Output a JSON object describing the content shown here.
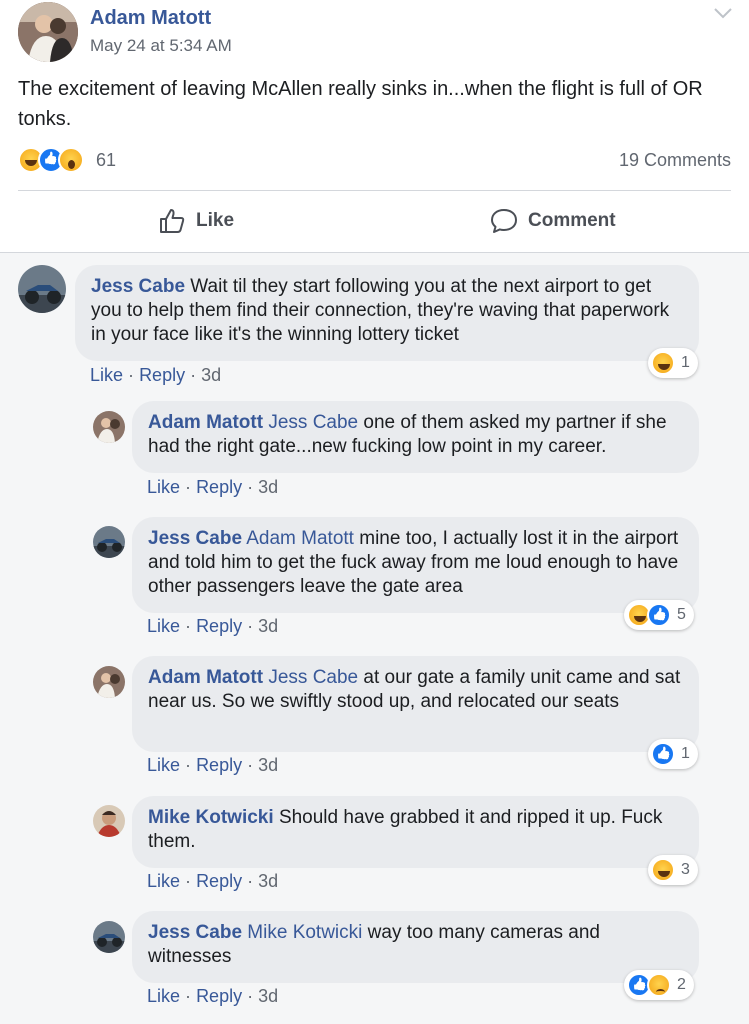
{
  "post": {
    "author": "Adam Matott",
    "time": "May 24 at 5:34 AM",
    "text": "The excitement of leaving McAllen really sinks in...when the flight is full of OR tonks.",
    "reaction_icons": [
      "haha-icon",
      "like-icon",
      "wow-icon"
    ],
    "reaction_count": "61",
    "comment_count": "19 Comments"
  },
  "actions": {
    "like_label": "Like",
    "comment_label": "Comment"
  },
  "comment_links": {
    "like": "Like",
    "reply": "Reply",
    "sep": "·"
  },
  "comments": [
    {
      "name": "Jess Cabe",
      "tag": "",
      "text": "Wait til they start following you at the next airport to get you to help them find their connection, they're waving that paperwork in your face like it's the winning lottery ticket",
      "age": "3d",
      "reaction_count": "1",
      "reactions": [
        "haha-icon"
      ]
    },
    {
      "name": "Adam Matott",
      "tag": "Jess Cabe",
      "text": "one of them asked my partner if she had the right gate...new fucking low point in my career.",
      "age": "3d",
      "reaction_count": "",
      "reactions": []
    },
    {
      "name": "Jess Cabe",
      "tag": "Adam Matott",
      "text": "mine too, I actually lost it in the airport and told him to get the fuck away from me loud enough to have other passengers leave the gate area",
      "age": "3d",
      "reaction_count": "5",
      "reactions": [
        "haha-icon",
        "like-icon"
      ]
    },
    {
      "name": "Adam Matott",
      "tag": "Jess Cabe",
      "text": "at our gate a family unit came and sat near us. So we swiftly stood up, and relocated our seats",
      "age": "3d",
      "reaction_count": "1",
      "reactions": [
        "like-icon"
      ]
    },
    {
      "name": "Mike Kotwicki",
      "tag": "",
      "text": "Should have grabbed it and ripped it up. Fuck them.",
      "age": "3d",
      "reaction_count": "3",
      "reactions": [
        "haha-icon"
      ]
    },
    {
      "name": "Jess Cabe",
      "tag": "Mike Kotwicki",
      "text": "way too many cameras and witnesses",
      "age": "3d",
      "reaction_count": "2",
      "reactions": [
        "like-icon",
        "sad-icon"
      ]
    }
  ]
}
